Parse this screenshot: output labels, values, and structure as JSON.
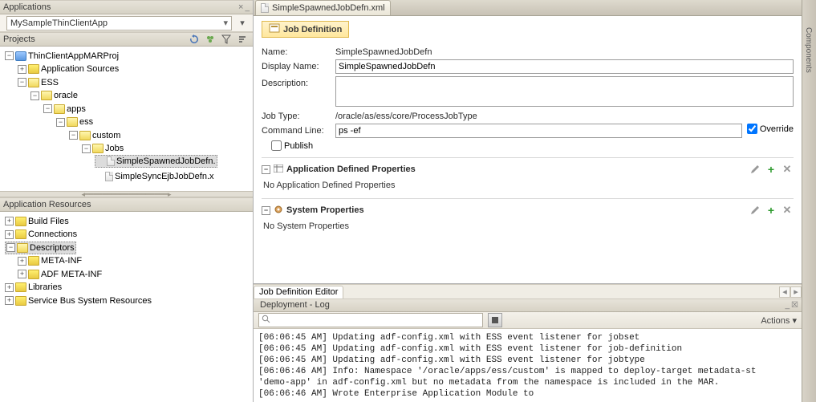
{
  "applications_panel": {
    "title": "Applications",
    "app_combo": "MySampleThinClientApp"
  },
  "projects_panel": {
    "title": "Projects"
  },
  "project_tree": {
    "root": "ThinClientAppMARProj",
    "app_sources": "Application Sources",
    "ess": "ESS",
    "oracle": "oracle",
    "apps": "apps",
    "ess2": "ess",
    "custom": "custom",
    "jobs": "Jobs",
    "file1": "SimpleSpawnedJobDefn.",
    "file2": "SimpleSyncEjbJobDefn.x"
  },
  "app_resources_panel": {
    "title": "Application Resources"
  },
  "app_resources_tree": {
    "build": "Build Files",
    "conn": "Connections",
    "desc": "Descriptors",
    "meta": "META-INF",
    "adfmeta": "ADF META-INF",
    "lib": "Libraries",
    "sbus": "Service Bus System Resources"
  },
  "editor": {
    "tab_title": "SimpleSpawnedJobDefn.xml",
    "section_title": "Job Definition",
    "labels": {
      "name": "Name:",
      "display_name": "Display Name:",
      "description": "Description:",
      "job_type": "Job Type:",
      "command_line": "Command Line:",
      "publish": "Publish",
      "override": "Override"
    },
    "values": {
      "name": "SimpleSpawnedJobDefn",
      "display_name": "SimpleSpawnedJobDefn",
      "description": "",
      "job_type": "/oracle/as/ess/core/ProcessJobType",
      "command_line": "ps -ef",
      "override_checked": true,
      "publish_checked": false
    },
    "app_props": {
      "heading": "Application Defined Properties",
      "empty": "No Application Defined Properties"
    },
    "sys_props": {
      "heading": "System Properties",
      "empty": "No System Properties"
    },
    "bottom_tab": "Job Definition Editor"
  },
  "log": {
    "header": "Deployment - Log",
    "actions_label": "Actions",
    "lines": [
      "[06:06:45 AM] Updating adf-config.xml with ESS event listener for jobset",
      "[06:06:45 AM] Updating adf-config.xml with ESS event listener for job-definition",
      "[06:06:45 AM] Updating adf-config.xml with ESS event listener for jobtype",
      "[06:06:46 AM] Info: Namespace '/oracle/apps/ess/custom' is mapped to deploy-target metadata-st",
      "'demo-app' in adf-config.xml but no metadata from the namespace is included in the MAR.",
      "[06:06:46 AM] Wrote Enterprise Application Module to"
    ]
  },
  "side_rail": {
    "label": "Components"
  }
}
